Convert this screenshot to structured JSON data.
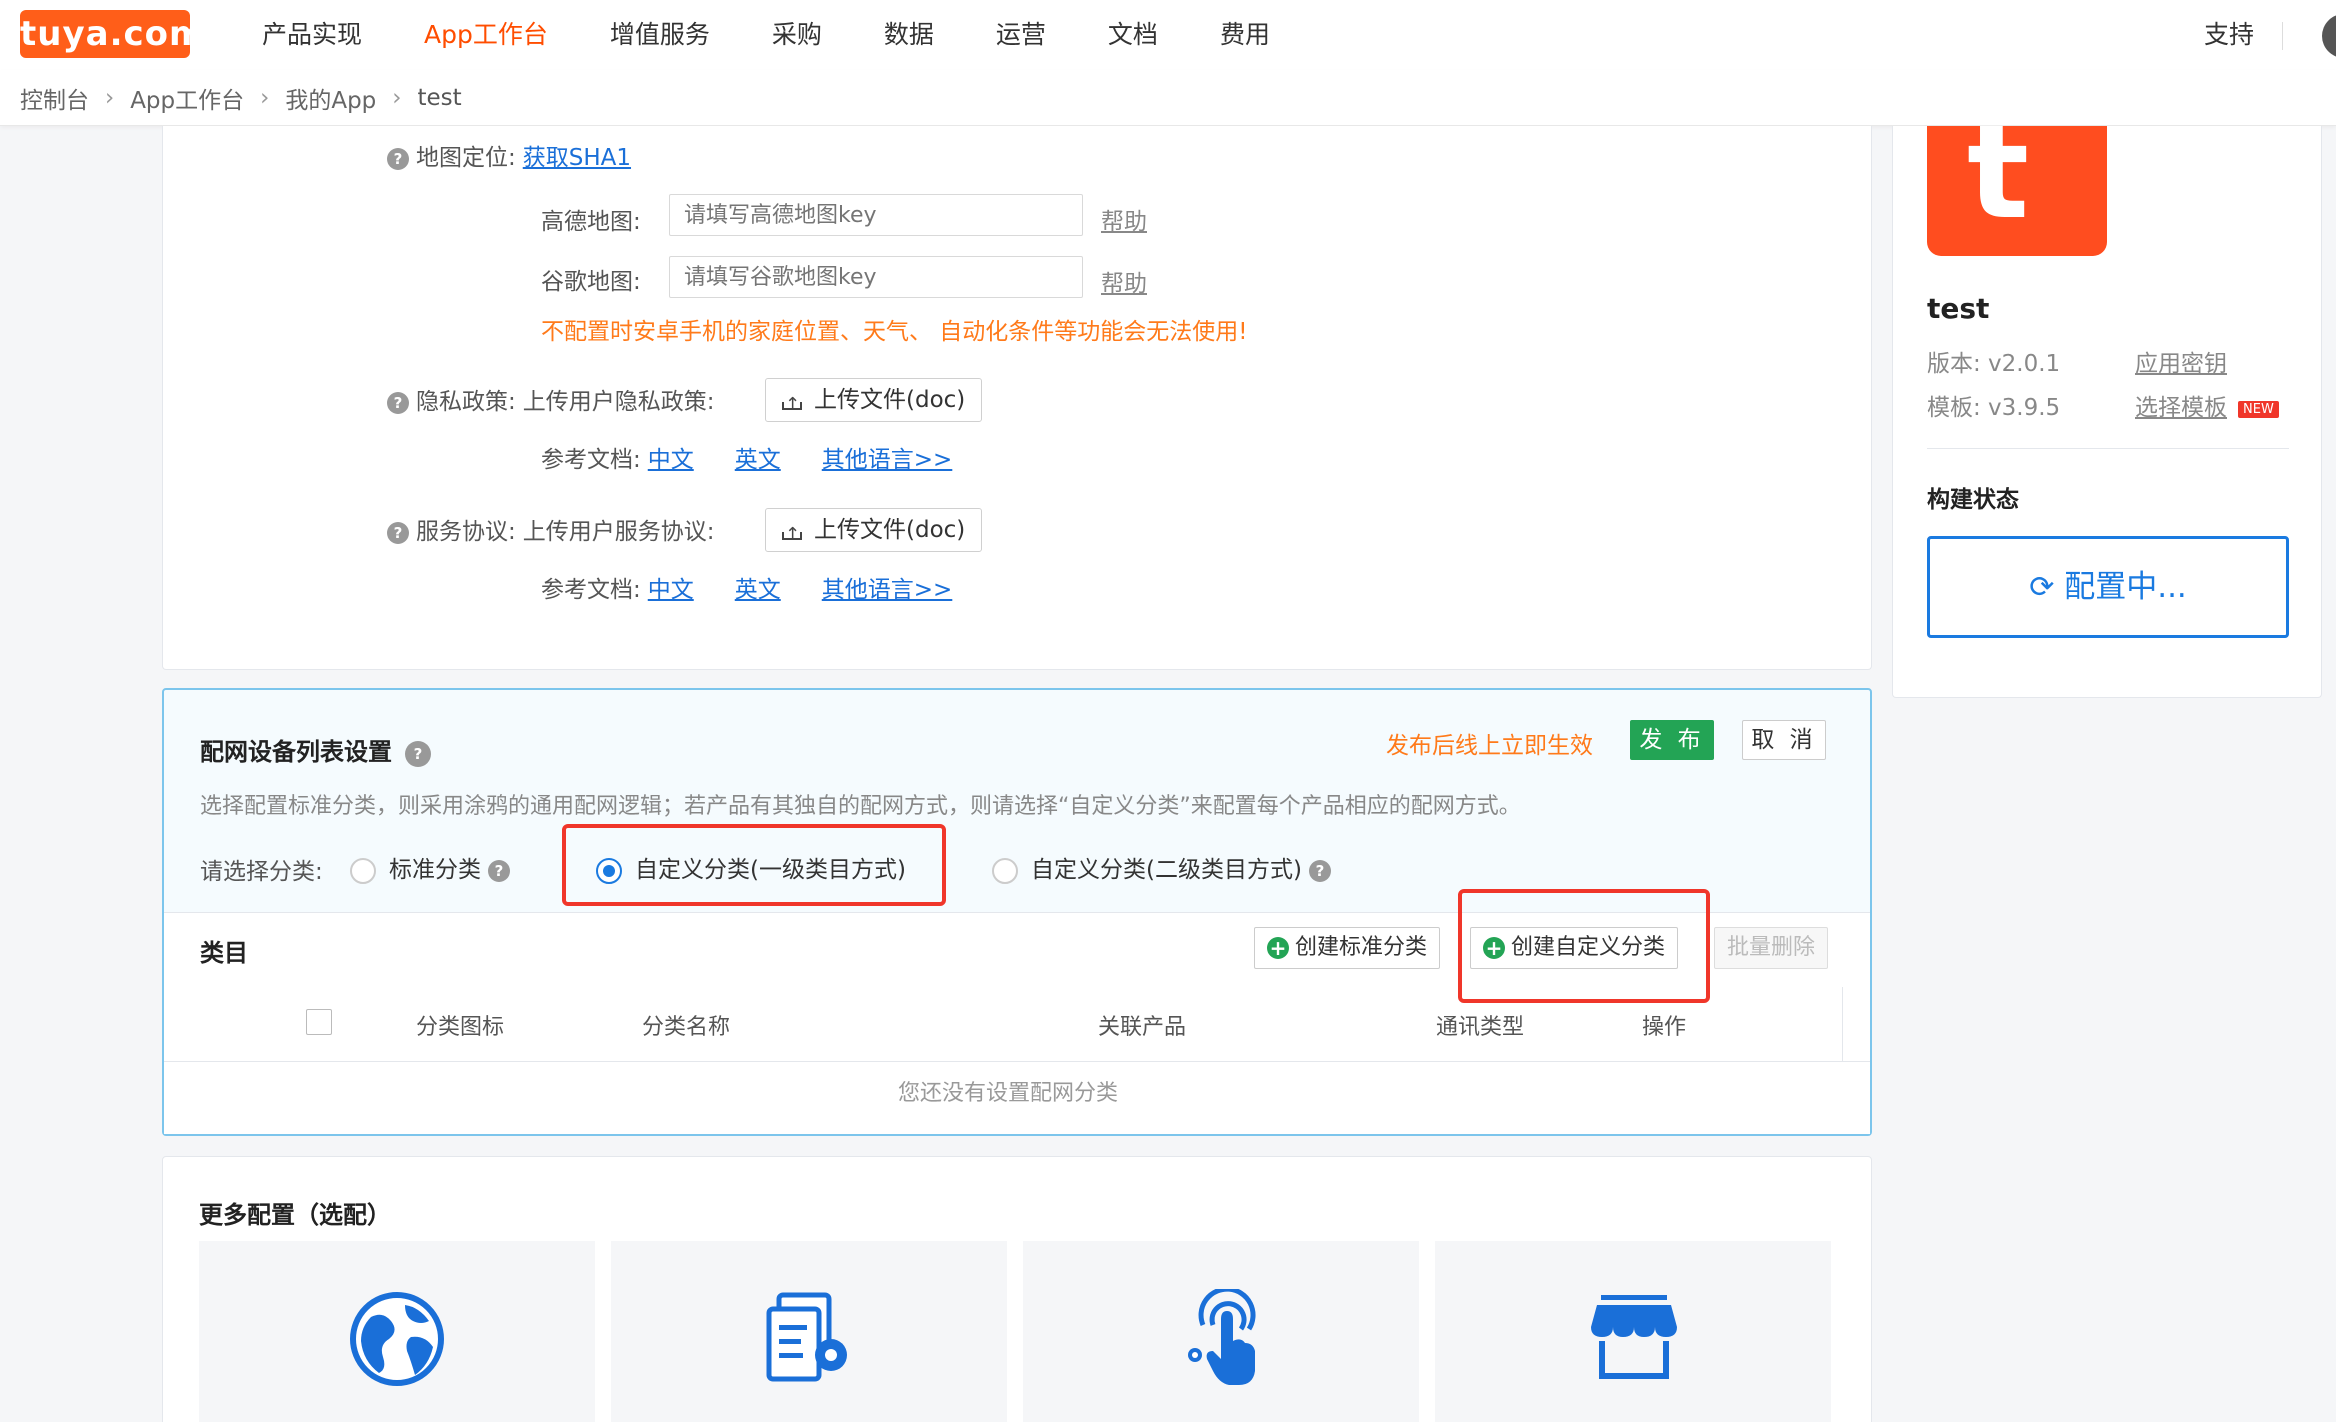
{
  "logo": {
    "text": "tuya.com"
  },
  "nav": {
    "items": [
      "产品实现",
      "App工作台",
      "增值服务",
      "采购",
      "数据",
      "运营",
      "文档",
      "费用"
    ],
    "active": "App工作台",
    "support": "支持"
  },
  "breadcrumb": [
    "控制台",
    "App工作台",
    "我的App",
    "test"
  ],
  "map": {
    "label": "地图定位:",
    "sha1_link": "获取SHA1",
    "gaode_label": "高德地图:",
    "gaode_placeholder": "请填写高德地图key",
    "google_label": "谷歌地图:",
    "google_placeholder": "请填写谷歌地图key",
    "help": "帮助",
    "warning": "不配置时安卓手机的家庭位置、天气、 自动化条件等功能会无法使用!"
  },
  "privacy": {
    "label": "隐私政策:",
    "upload_label": "上传用户隐私政策:",
    "upload_button": "上传文件(doc)",
    "ref_label": "参考文档:",
    "ref_links": [
      "中文",
      "英文",
      "其他语言>>"
    ]
  },
  "service": {
    "label": "服务协议:",
    "upload_label": "上传用户服务协议:",
    "upload_button": "上传文件(doc)",
    "ref_label": "参考文档:",
    "ref_links": [
      "中文",
      "英文",
      "其他语言>>"
    ]
  },
  "network_list": {
    "title": "配网设备列表设置",
    "publish_hint": "发布后线上立即生效",
    "publish_button": "发 布",
    "cancel_button": "取 消",
    "description": "选择配置标准分类，则采用涂鸦的通用配网逻辑；若产品有其独自的配网方式，则请选择“自定义分类”来配置每个产品相应的配网方式。",
    "select_label": "请选择分类:",
    "options": [
      "标准分类",
      "自定义分类(一级类目方式)",
      "自定义分类(二级类目方式)"
    ],
    "selected": "自定义分类(一级类目方式)",
    "category_title": "类目",
    "btn_create_standard": "创建标准分类",
    "btn_create_custom": "创建自定义分类",
    "btn_batch_delete": "批量删除",
    "columns": [
      "分类图标",
      "分类名称",
      "关联产品",
      "通讯类型",
      "操作"
    ],
    "empty_text": "您还没有设置配网分类"
  },
  "more_config": {
    "title": "更多配置（选配）",
    "cards": [
      "globe-icon",
      "document-gear-icon",
      "touch-icon",
      "store-icon"
    ]
  },
  "app_info": {
    "name": "test",
    "version": "版本: v2.0.1",
    "template": "模板: v3.9.5",
    "app_key_link": "应用密钥",
    "template_link": "选择模板",
    "new_badge": "NEW",
    "build_status_title": "构建状态",
    "build_status_button": "配置中..."
  },
  "colors": {
    "brand": "#ff5e19",
    "link": "#1a6fd8",
    "warn": "#ff7a1a",
    "publish": "#23a455",
    "highlight": "#f0362a"
  }
}
